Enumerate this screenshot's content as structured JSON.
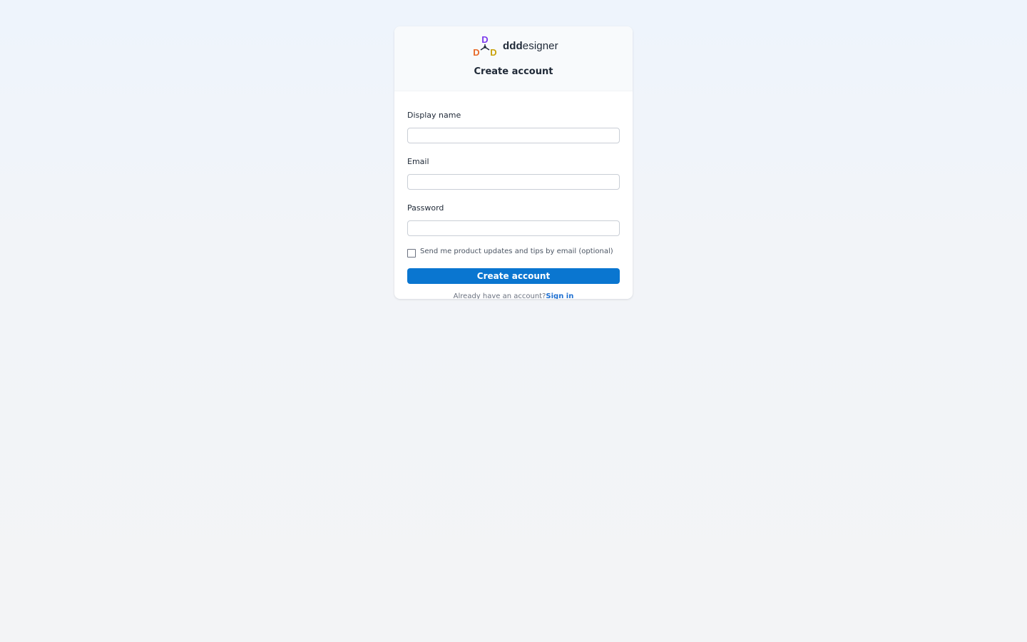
{
  "brand": {
    "logo_bold": "ddd",
    "logo_rest": "esigner",
    "logo_mark_letters": [
      "D",
      "D",
      "D"
    ],
    "logo_colors": {
      "top": "#7c3aed",
      "left": "#e86a2a",
      "right": "#c9a10a"
    }
  },
  "header": {
    "title": "Create account"
  },
  "form": {
    "display_name": {
      "label": "Display name",
      "value": "",
      "placeholder": ""
    },
    "email": {
      "label": "Email",
      "value": "",
      "placeholder": ""
    },
    "password": {
      "label": "Password",
      "value": "",
      "placeholder": ""
    },
    "marketing_opt_in": {
      "label": "Send me product updates and tips by email (optional)",
      "checked": false
    },
    "submit_label": "Create account"
  },
  "footer": {
    "prompt": "Already have an account?",
    "link_label": "Sign in"
  },
  "colors": {
    "primary": "#0a76d0",
    "link": "#1d6fd1"
  }
}
